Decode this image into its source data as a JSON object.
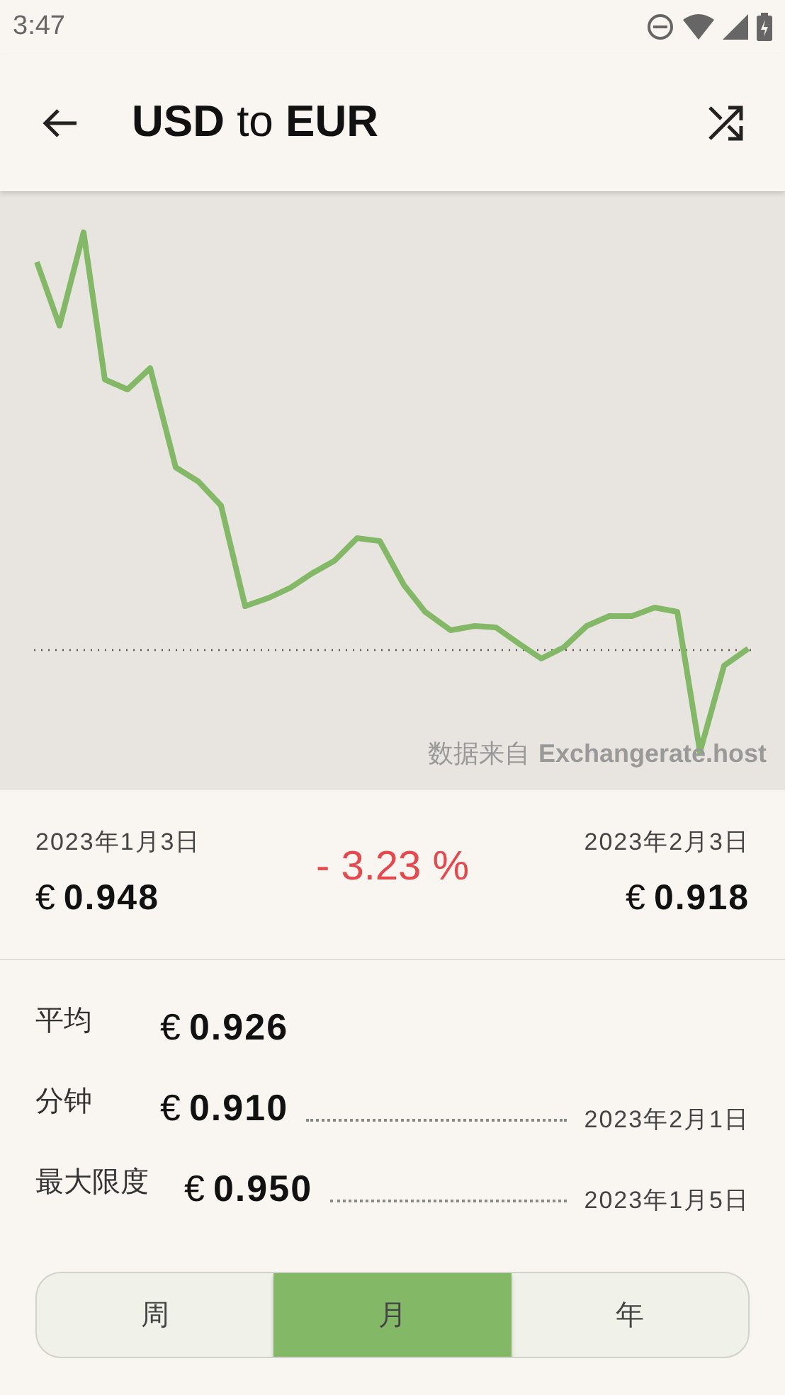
{
  "status_bar": {
    "time": "3:47"
  },
  "app_bar": {
    "title": "**USD** to **EUR**"
  },
  "chart": {
    "source_label": "数据来自",
    "source_name": "Exchangerate.host"
  },
  "summary": {
    "start_date": "2023年1月3日",
    "start_value": "0.948",
    "change": "- 3.23 %",
    "end_date": "2023年2月3日",
    "end_value": "0.918",
    "currency": "€"
  },
  "stats": [
    {
      "label": "平均",
      "value": "0.926"
    },
    {
      "label": "分钟",
      "value": "0.910",
      "date": "2023年2月1日"
    },
    {
      "label": "最大限度",
      "value": "0.950",
      "date": "2023年1月5日"
    }
  ],
  "periods": [
    {
      "label": "周",
      "selected": false
    },
    {
      "label": "月",
      "selected": true
    },
    {
      "label": "年",
      "selected": false
    }
  ]
}
